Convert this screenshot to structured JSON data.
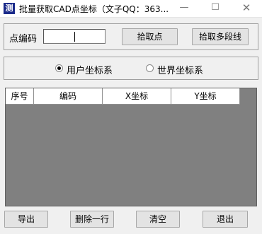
{
  "window": {
    "title": "批量获取CAD点坐标（文子QQ：363...",
    "icon": "app-logo-icon",
    "icon_glyph": "测",
    "minimize_glyph": "—",
    "maximize_glyph": "☐",
    "close_glyph": "✕"
  },
  "point_section": {
    "label": "点编码",
    "input_value": "",
    "pick_point_label": "拾取点",
    "pick_polyline_label": "拾取多段线"
  },
  "coord_system": {
    "options": [
      {
        "label": "用户坐标系",
        "checked": true
      },
      {
        "label": "世界坐标系",
        "checked": false
      }
    ]
  },
  "table": {
    "columns": [
      "序号",
      "编码",
      "X坐标",
      "Y坐标"
    ],
    "rows": []
  },
  "footer": {
    "export_label": "导出",
    "delete_row_label": "删除一行",
    "clear_label": "清空",
    "exit_label": "退出"
  }
}
